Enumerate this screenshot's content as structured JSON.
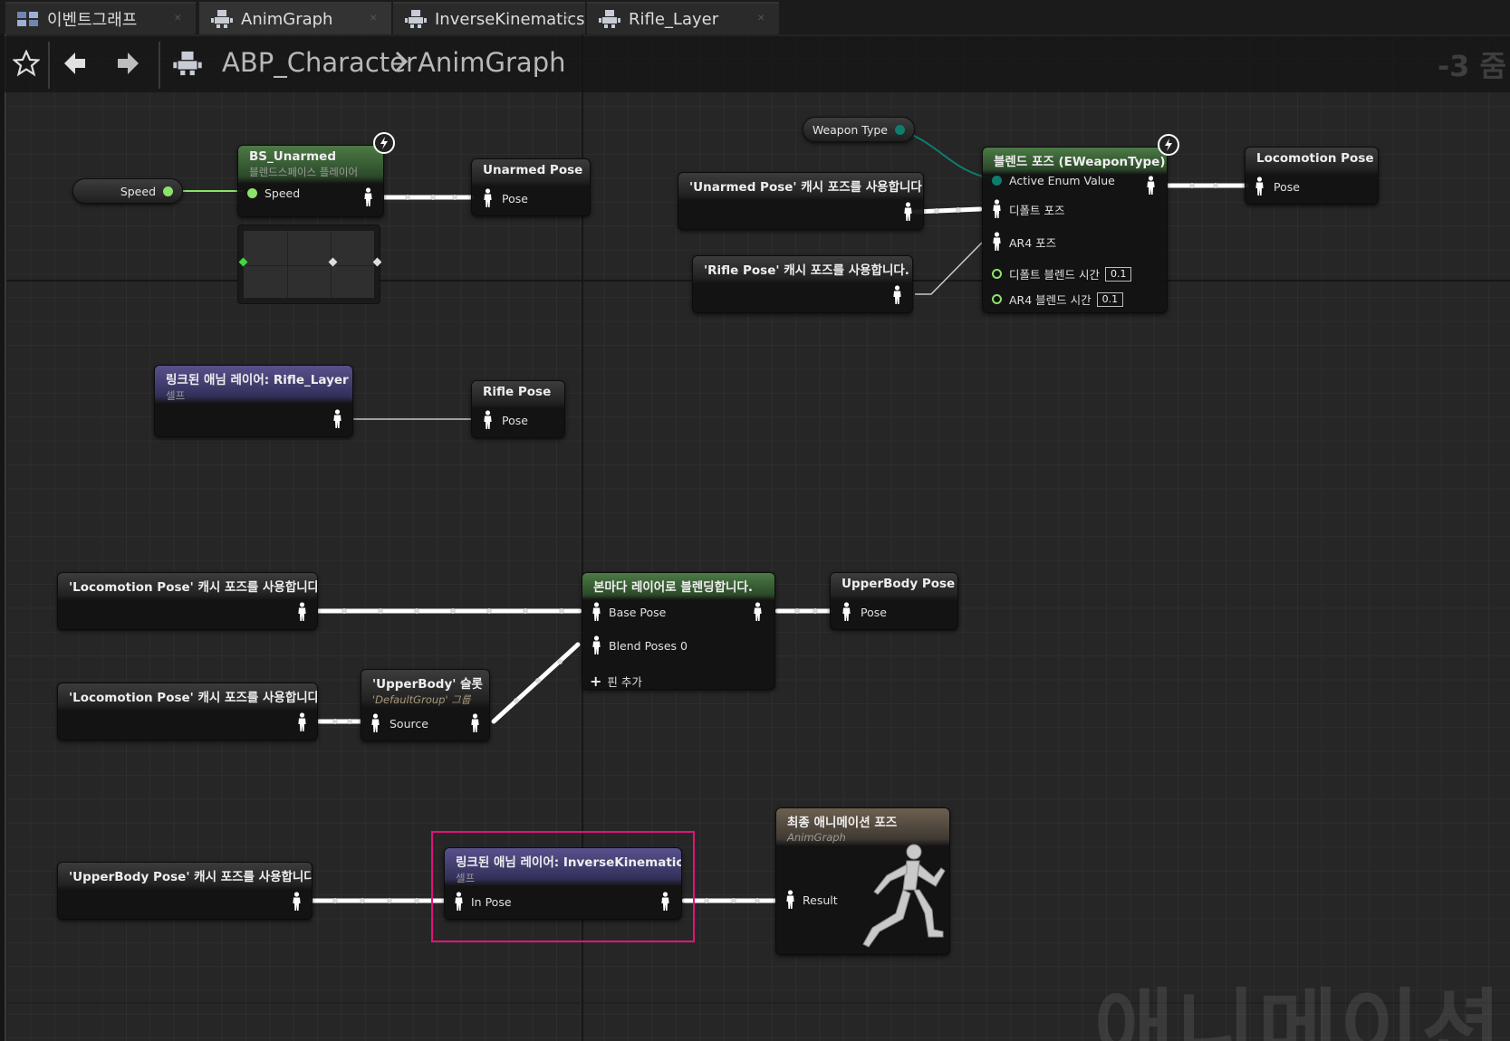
{
  "tabs": [
    {
      "label": "이벤트그래프",
      "icon": "event-graph-icon"
    },
    {
      "label": "AnimGraph",
      "icon": "anim-graph-icon"
    },
    {
      "label": "InverseKinematics",
      "icon": "anim-graph-icon"
    },
    {
      "label": "Rifle_Layer",
      "icon": "anim-graph-icon"
    }
  ],
  "breadcrumb": {
    "blueprint": "ABP_Character",
    "graph": "AnimGraph",
    "zoom": "-3 줌"
  },
  "watermark": "애니메이션",
  "nodes": {
    "speed_var": {
      "label": "Speed"
    },
    "weapon_type_var": {
      "label": "Weapon Type"
    },
    "bs_unarmed": {
      "title": "BS_Unarmed",
      "subtitle": "블렌드스페이스 플레이어",
      "pin_speed": "Speed"
    },
    "unarmed_pose": {
      "title": "Unarmed Pose",
      "pin": "Pose"
    },
    "use_unarmed_cache": {
      "title": "'Unarmed Pose' 캐시 포즈를 사용합니다."
    },
    "use_rifle_cache": {
      "title": "'Rifle Pose' 캐시 포즈를 사용합니다."
    },
    "blend_poses": {
      "title": "블렌드 포즈 (EWeaponType)",
      "pin_enum": "Active Enum Value",
      "pin_default": "디폴트 포즈",
      "pin_ar4": "AR4 포즈",
      "pin_default_time": "디폴트 블렌드 시간",
      "default_time_value": "0.1",
      "pin_ar4_time": "AR4 블렌드 시간",
      "ar4_time_value": "0.1"
    },
    "locomotion_pose": {
      "title": "Locomotion Pose",
      "pin": "Pose"
    },
    "linked_rifle_layer": {
      "title": "링크된 애님 레이어: Rifle_Layer",
      "subtitle": "셀프"
    },
    "rifle_pose": {
      "title": "Rifle Pose",
      "pin": "Pose"
    },
    "use_locomotion_cache_1": {
      "title": "'Locomotion Pose' 캐시 포즈를 사용합니다."
    },
    "use_locomotion_cache_2": {
      "title": "'Locomotion Pose' 캐시 포즈를 사용합니다."
    },
    "layered_blend": {
      "title": "본마다 레이어로 블렌딩합니다.",
      "pin_base": "Base Pose",
      "pin_blend": "Blend Poses 0",
      "add_pin": "핀 추가"
    },
    "upperbody_slot": {
      "title": "'UpperBody' 슬롯",
      "subtitle": "'DefaultGroup' 그룹",
      "pin": "Source"
    },
    "upperbody_pose": {
      "title": "UpperBody Pose",
      "pin": "Pose"
    },
    "use_upperbody_cache": {
      "title": "'UpperBody Pose' 캐시 포즈를 사용합니다."
    },
    "linked_ik_layer": {
      "title": "링크된 애님 레이어: InverseKinematics",
      "subtitle": "셀프",
      "pin": "In Pose"
    },
    "output_pose": {
      "title": "최종 애니메이션 포즈",
      "subtitle": "AnimGraph",
      "pin": "Result"
    }
  },
  "colors": {
    "pose_wire": "#ffffff",
    "float_pin": "#8ce26a",
    "enum_pin": "#0e7d6e",
    "highlight": "#e0137a"
  }
}
